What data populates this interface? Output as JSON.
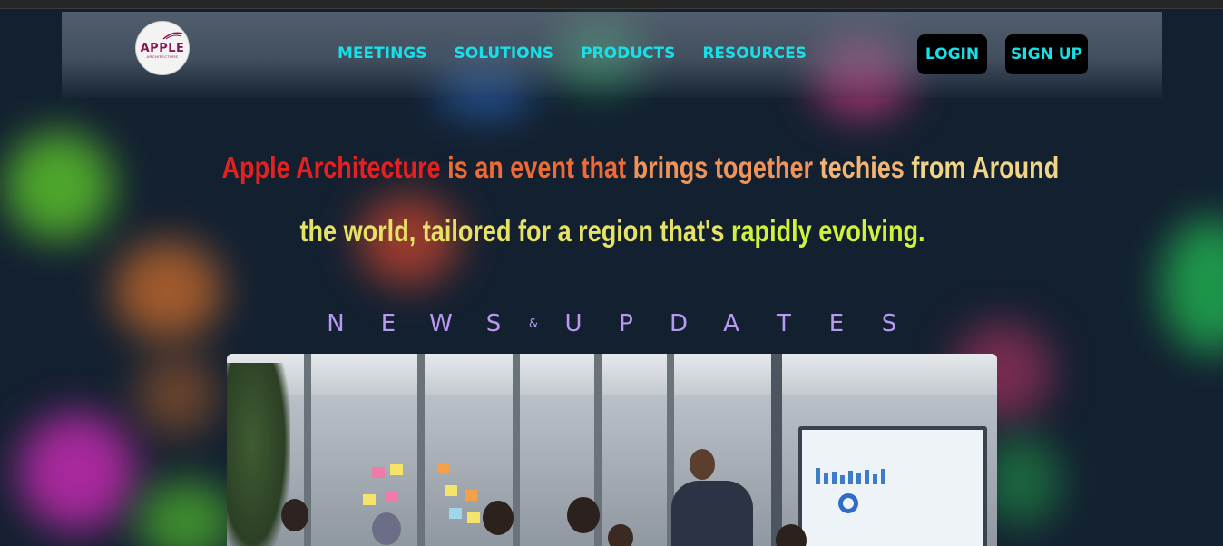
{
  "logo": {
    "word": "APPLE",
    "sub": "ARCHITECTURE"
  },
  "nav": {
    "items": [
      {
        "label": "MEETINGS"
      },
      {
        "label": "SOLUTIONS"
      },
      {
        "label": "PRODUCTS"
      },
      {
        "label": "RESOURCES"
      }
    ],
    "login_label": "LOGIN",
    "signup_label": "SIGN UP"
  },
  "hero": {
    "line1": [
      {
        "text": "Apple Architecture",
        "color": "#e52020"
      },
      {
        "text": "is an event that",
        "color": "#ef6b35"
      },
      {
        "text": "brings together",
        "color": "#f0935a"
      },
      {
        "text": "techies",
        "color": "#f2b476"
      },
      {
        "text": "from Around",
        "color": "#f0d488"
      }
    ],
    "line2": [
      {
        "text": "the world, tailored for a region that's",
        "color": "#e6e266"
      },
      {
        "text": "rapidly evolving.",
        "color": "#cff23a"
      }
    ]
  },
  "news": {
    "title_letters_1": [
      "N",
      "E",
      "W",
      "S"
    ],
    "amp": "&",
    "title_letters_2": [
      "U",
      "P",
      "D",
      "A",
      "T",
      "E",
      "S"
    ]
  },
  "colors": {
    "nav_text": "#17e0e8",
    "background": "#132030",
    "news_title": "#b799f2"
  }
}
